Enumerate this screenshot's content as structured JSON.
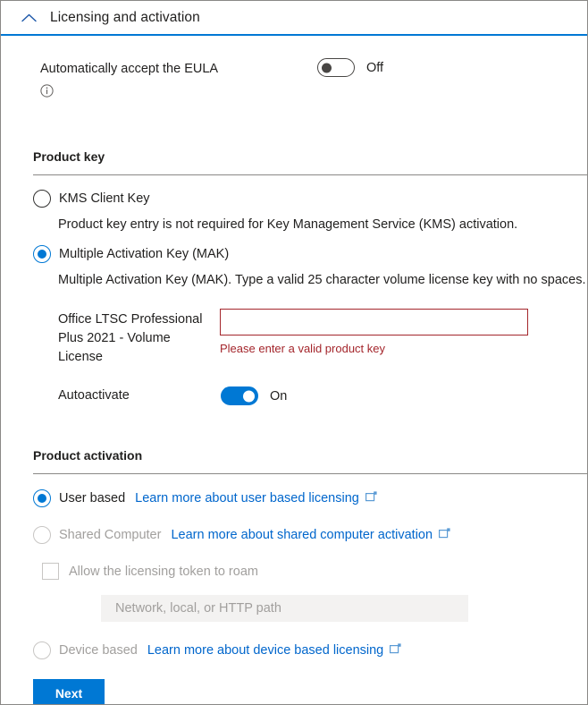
{
  "header": {
    "title": "Licensing and activation",
    "collapse_icon": "chevron-up-icon",
    "accent_color": "#0078d4"
  },
  "eula": {
    "label": "Automatically accept the EULA",
    "info_icon": "info-circle-icon",
    "toggle_state": "Off",
    "toggle_on": false
  },
  "product_key": {
    "section_title": "Product key",
    "options": [
      {
        "id": "kms",
        "label": "KMS Client Key",
        "selected": false,
        "description": "Product key entry is not required for Key Management Service (KMS) activation."
      },
      {
        "id": "mak",
        "label": "Multiple Activation Key (MAK)",
        "selected": true,
        "description": "Multiple Activation Key (MAK). Type a valid 25 character volume license key with no spaces."
      }
    ],
    "key_field": {
      "label": "Office LTSC Professional Plus 2021 - Volume License",
      "value": "",
      "placeholder": "",
      "error": "Please enter a valid product key",
      "error_color": "#a4262c"
    },
    "autoactivate": {
      "label": "Autoactivate",
      "toggle_state": "On",
      "toggle_on": true
    }
  },
  "product_activation": {
    "section_title": "Product activation",
    "options": [
      {
        "id": "user-based",
        "label": "User based",
        "selected": true,
        "disabled": false,
        "link_text": "Learn more about user based licensing",
        "link_icon": "open-in-new-window-icon"
      },
      {
        "id": "shared-computer",
        "label": "Shared Computer",
        "selected": false,
        "disabled": true,
        "link_text": "Learn more about shared computer activation",
        "link_icon": "open-in-new-window-icon"
      },
      {
        "id": "device-based",
        "label": "Device based",
        "selected": false,
        "disabled": true,
        "link_text": "Learn more about device based licensing",
        "link_icon": "open-in-new-window-icon"
      }
    ],
    "roam_checkbox": {
      "label": "Allow the licensing token to roam",
      "checked": false,
      "disabled": true
    },
    "token_path": {
      "value": "",
      "placeholder": "Network, local, or HTTP path"
    }
  },
  "footer": {
    "next_label": "Next"
  }
}
